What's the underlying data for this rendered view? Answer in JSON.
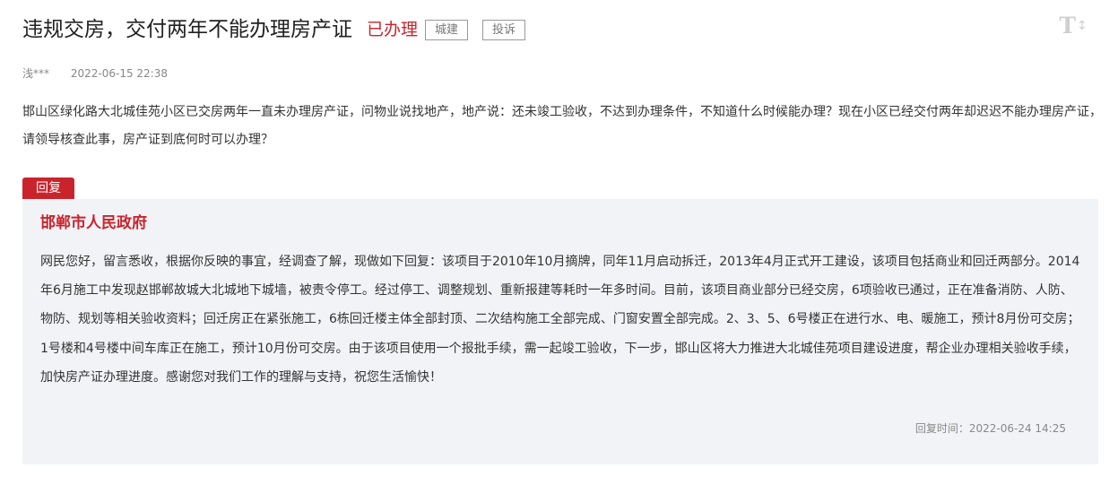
{
  "header": {
    "title": "违规交房，交付两年不能办理房产证",
    "status": "已办理",
    "tags": [
      "城建",
      "投诉"
    ],
    "font_toggle_glyph": "T",
    "font_toggle_arrows": "↕",
    "icon": "font-size-toggle-icon"
  },
  "meta": {
    "author": "浅***",
    "time": "2022-06-15 22:38"
  },
  "question": {
    "text": "邯山区绿化路大北城佳苑小区已交房两年一直未办理房产证，问物业说找地产，地产说：还未竣工验收，不达到办理条件，不知道什么时候能办理？现在小区已经交付两年却迟迟不能办理房产证，请领导核查此事，房产证到底何时可以办理？"
  },
  "reply": {
    "tab_label": "回复",
    "organization": "邯郸市人民政府",
    "content": "网民您好，留言悉收，根据你反映的事宜，经调查了解，现做如下回复：该项目于2010年10月摘牌，同年11月启动拆迁，2013年4月正式开工建设，该项目包括商业和回迁两部分。2014年6月施工中发现赵邯郸故城大北城地下城墙，被责令停工。经过停工、调整规划、重新报建等耗时一年多时间。目前，该项目商业部分已经交房，6项验收已通过，正在准备消防、人防、物防、规划等相关验收资料；回迁房正在紧张施工，6栋回迁楼主体全部封顶、二次结构施工全部完成、门窗安置全部完成。2、3、5、6号楼正在进行水、电、暖施工，预计8月份可交房；1号楼和4号楼中间车库正在施工，预计10月份可交房。由于该项目使用一个报批手续，需一起竣工验收，下一步，邯山区将大力推进大北城佳苑项目建设进度，帮企业办理相关验收手续，加快房产证办理进度。感谢您对我们工作的理解与支持，祝您生活愉快！",
    "time_label": "回复时间：",
    "time": "2022-06-24 14:25"
  },
  "colors": {
    "accent": "#c9242c",
    "reply_bg": "#f2f3f7",
    "meta_text": "#888888"
  }
}
